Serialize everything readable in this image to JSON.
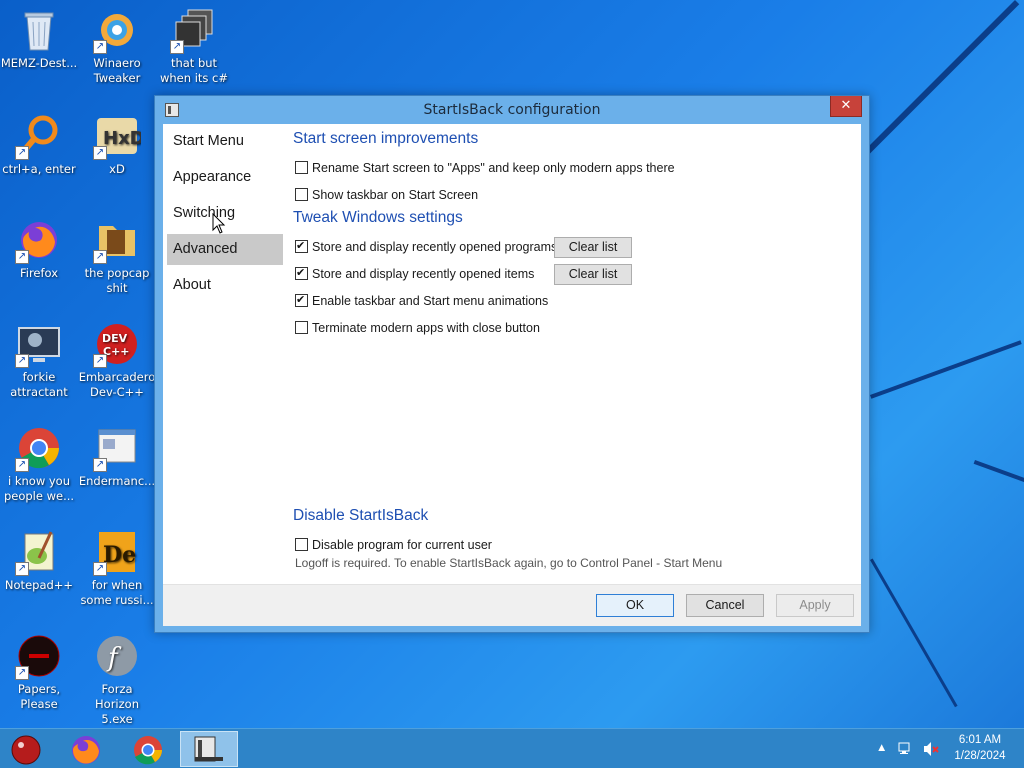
{
  "desktop": {
    "icons": [
      {
        "label": "MEMZ-Dest...",
        "icon": "recycle-bin-icon"
      },
      {
        "label": "Winaero Tweaker",
        "icon": "winaero-icon"
      },
      {
        "label": "that but when its c#",
        "icon": "stacked-windows-icon"
      },
      {
        "label": "ctrl+a, enter",
        "icon": "magnifier-icon"
      },
      {
        "label": "xD",
        "icon": "hxd-icon"
      },
      {
        "label": "Firefox",
        "icon": "firefox-icon"
      },
      {
        "label": "the popcap shit",
        "icon": "folder-icon"
      },
      {
        "label": "forkie attractant",
        "icon": "monitor-gear-icon"
      },
      {
        "label": "Embarcadero Dev-C++",
        "icon": "devcpp-icon"
      },
      {
        "label": "i know you people we...",
        "icon": "chrome-icon"
      },
      {
        "label": "Endermanc...",
        "icon": "window-app-icon"
      },
      {
        "label": "Notepad++",
        "icon": "notepadpp-icon"
      },
      {
        "label": "for when some russi...",
        "icon": "de-icon"
      },
      {
        "label": "Papers, Please",
        "icon": "papers-please-icon"
      },
      {
        "label": "Forza Horizon 5.exe",
        "icon": "flash-icon"
      }
    ]
  },
  "window": {
    "title": "StartIsBack configuration",
    "close_label": "✕",
    "nav": [
      {
        "label": "Start Menu"
      },
      {
        "label": "Appearance"
      },
      {
        "label": "Switching"
      },
      {
        "label": "Advanced"
      },
      {
        "label": "About"
      }
    ],
    "active_nav": "Advanced",
    "sections": {
      "start_screen": {
        "heading": "Start screen improvements",
        "options": [
          {
            "label": "Rename Start screen to \"Apps\" and keep only modern apps there",
            "checked": false
          },
          {
            "label": "Show taskbar on Start Screen",
            "checked": false
          }
        ]
      },
      "tweak": {
        "heading": "Tweak Windows settings",
        "options": [
          {
            "label": "Store and display recently opened programs",
            "checked": true
          },
          {
            "label": "Store and display recently opened items",
            "checked": true
          },
          {
            "label": "Enable taskbar and Start menu animations",
            "checked": true
          },
          {
            "label": "Terminate modern apps with close button",
            "checked": false
          }
        ],
        "clear_list_label": "Clear list"
      },
      "disable": {
        "heading": "Disable StartIsBack",
        "option": {
          "label": "Disable program for current user",
          "checked": false
        },
        "note": "Logoff is required. To enable StartIsBack again, go to Control Panel - Start Menu"
      }
    },
    "buttons": {
      "ok": "OK",
      "cancel": "Cancel",
      "apply": "Apply"
    }
  },
  "taskbar": {
    "items": [
      "start-orb-icon",
      "firefox-icon",
      "chrome-icon",
      "startisback-config-icon"
    ],
    "time": "6:01 AM",
    "date": "1/28/2024",
    "tray_icons": [
      "show-hidden-icons-chevron-icon",
      "network-icon",
      "volume-muted-icon"
    ]
  }
}
